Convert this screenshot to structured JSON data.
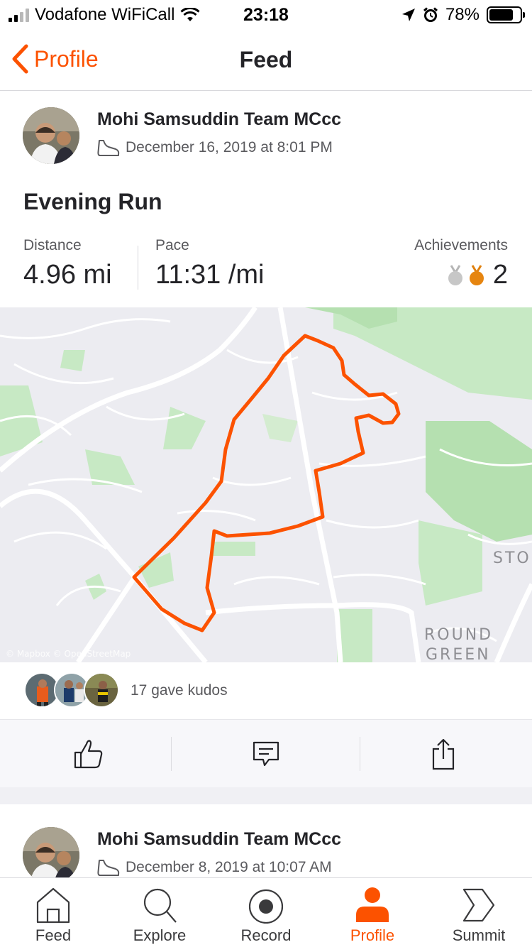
{
  "status_bar": {
    "carrier": "Vodafone WiFiCall",
    "time": "23:18",
    "battery": "78%",
    "battery_level": 0.78
  },
  "nav": {
    "back_label": "Profile",
    "title": "Feed"
  },
  "activity": {
    "athlete_name": "Mohi Samsuddin Team MCcc",
    "date": "December 16, 2019 at 8:01 PM",
    "title": "Evening Run",
    "stats": {
      "distance_label": "Distance",
      "distance_value": "4.96 mi",
      "pace_label": "Pace",
      "pace_value": "11:31 /mi",
      "achievements_label": "Achievements",
      "achievements_value": "2"
    },
    "map": {
      "labels": [
        "STO",
        "ROUND",
        "GREEN"
      ],
      "attribution": "© Mapbox © OpenStreetMap",
      "route_color": "#fc5200"
    },
    "kudos_text": "17 gave kudos"
  },
  "next_activity": {
    "athlete_name": "Mohi Samsuddin Team MCcc",
    "date": "December 8, 2019 at 10:07 AM"
  },
  "actions": [
    {
      "name": "kudos",
      "icon": "thumbs-up-icon"
    },
    {
      "name": "comment",
      "icon": "comment-icon"
    },
    {
      "name": "share",
      "icon": "share-icon"
    }
  ],
  "tabs": [
    {
      "label": "Feed",
      "icon": "home-icon"
    },
    {
      "label": "Explore",
      "icon": "search-icon"
    },
    {
      "label": "Record",
      "icon": "record-icon"
    },
    {
      "label": "Profile",
      "icon": "person-icon",
      "active": true
    },
    {
      "label": "Summit",
      "icon": "summit-chevron-icon"
    }
  ],
  "colors": {
    "accent": "#fc5200",
    "map_green": "#c7e9c4",
    "map_background": "#ececf1"
  }
}
